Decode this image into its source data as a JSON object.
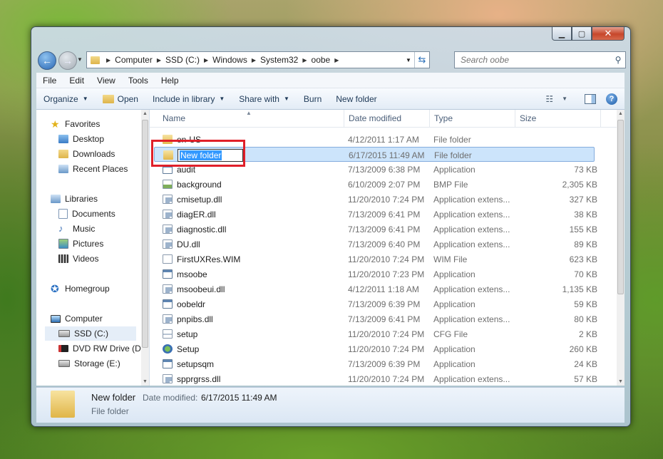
{
  "window": {
    "minimize": "▁",
    "maximize": "▢",
    "close": "✕"
  },
  "address": {
    "crumbs": [
      "Computer",
      "SSD (C:)",
      "Windows",
      "System32",
      "oobe"
    ]
  },
  "search": {
    "placeholder": "Search oobe"
  },
  "menu": [
    "File",
    "Edit",
    "View",
    "Tools",
    "Help"
  ],
  "toolbar": {
    "organize": "Organize",
    "open": "Open",
    "include": "Include in library",
    "share": "Share with",
    "burn": "Burn",
    "new_folder": "New folder",
    "help": "?"
  },
  "nav": {
    "favorites": "Favorites",
    "desktop": "Desktop",
    "downloads": "Downloads",
    "recent": "Recent Places",
    "libraries": "Libraries",
    "documents": "Documents",
    "music": "Music",
    "pictures": "Pictures",
    "videos": "Videos",
    "homegroup": "Homegroup",
    "computer": "Computer",
    "ssd": "SSD (C:)",
    "dvd": "DVD RW Drive (D",
    "storage": "Storage (E:)"
  },
  "columns": {
    "name": "Name",
    "date": "Date modified",
    "type": "Type",
    "size": "Size"
  },
  "files": [
    {
      "name": "en-US",
      "date": "4/12/2011 1:17 AM",
      "type": "File folder",
      "size": "",
      "icon": "folder"
    },
    {
      "name": "New folder",
      "date": "6/17/2015 11:49 AM",
      "type": "File folder",
      "size": "",
      "icon": "folder",
      "editing": true
    },
    {
      "name": "audit",
      "date": "7/13/2009 6:38 PM",
      "type": "Application",
      "size": "73 KB",
      "icon": "app"
    },
    {
      "name": "background",
      "date": "6/10/2009 2:07 PM",
      "type": "BMP File",
      "size": "2,305 KB",
      "icon": "bmp"
    },
    {
      "name": "cmisetup.dll",
      "date": "11/20/2010 7:24 PM",
      "type": "Application extens...",
      "size": "327 KB",
      "icon": "dll"
    },
    {
      "name": "diagER.dll",
      "date": "7/13/2009 6:41 PM",
      "type": "Application extens...",
      "size": "38 KB",
      "icon": "dll"
    },
    {
      "name": "diagnostic.dll",
      "date": "7/13/2009 6:41 PM",
      "type": "Application extens...",
      "size": "155 KB",
      "icon": "dll"
    },
    {
      "name": "DU.dll",
      "date": "7/13/2009 6:40 PM",
      "type": "Application extens...",
      "size": "89 KB",
      "icon": "dll"
    },
    {
      "name": "FirstUXRes.WIM",
      "date": "11/20/2010 7:24 PM",
      "type": "WIM File",
      "size": "623 KB",
      "icon": "wim"
    },
    {
      "name": "msoobe",
      "date": "11/20/2010 7:23 PM",
      "type": "Application",
      "size": "70 KB",
      "icon": "app"
    },
    {
      "name": "msoobeui.dll",
      "date": "4/12/2011 1:18 AM",
      "type": "Application extens...",
      "size": "1,135 KB",
      "icon": "dll"
    },
    {
      "name": "oobeldr",
      "date": "7/13/2009 6:39 PM",
      "type": "Application",
      "size": "59 KB",
      "icon": "app"
    },
    {
      "name": "pnpibs.dll",
      "date": "7/13/2009 6:41 PM",
      "type": "Application extens...",
      "size": "80 KB",
      "icon": "dll"
    },
    {
      "name": "setup",
      "date": "11/20/2010 7:24 PM",
      "type": "CFG File",
      "size": "2 KB",
      "icon": "cfg"
    },
    {
      "name": "Setup",
      "date": "11/20/2010 7:24 PM",
      "type": "Application",
      "size": "260 KB",
      "icon": "setup"
    },
    {
      "name": "setupsqm",
      "date": "7/13/2009 6:39 PM",
      "type": "Application",
      "size": "24 KB",
      "icon": "app"
    },
    {
      "name": "spprgrss.dll",
      "date": "11/20/2010 7:24 PM",
      "type": "Application extens...",
      "size": "57 KB",
      "icon": "dll"
    }
  ],
  "details": {
    "name": "New folder",
    "date_label": "Date modified:",
    "date_value": "6/17/2015 11:49 AM",
    "type": "File folder"
  }
}
